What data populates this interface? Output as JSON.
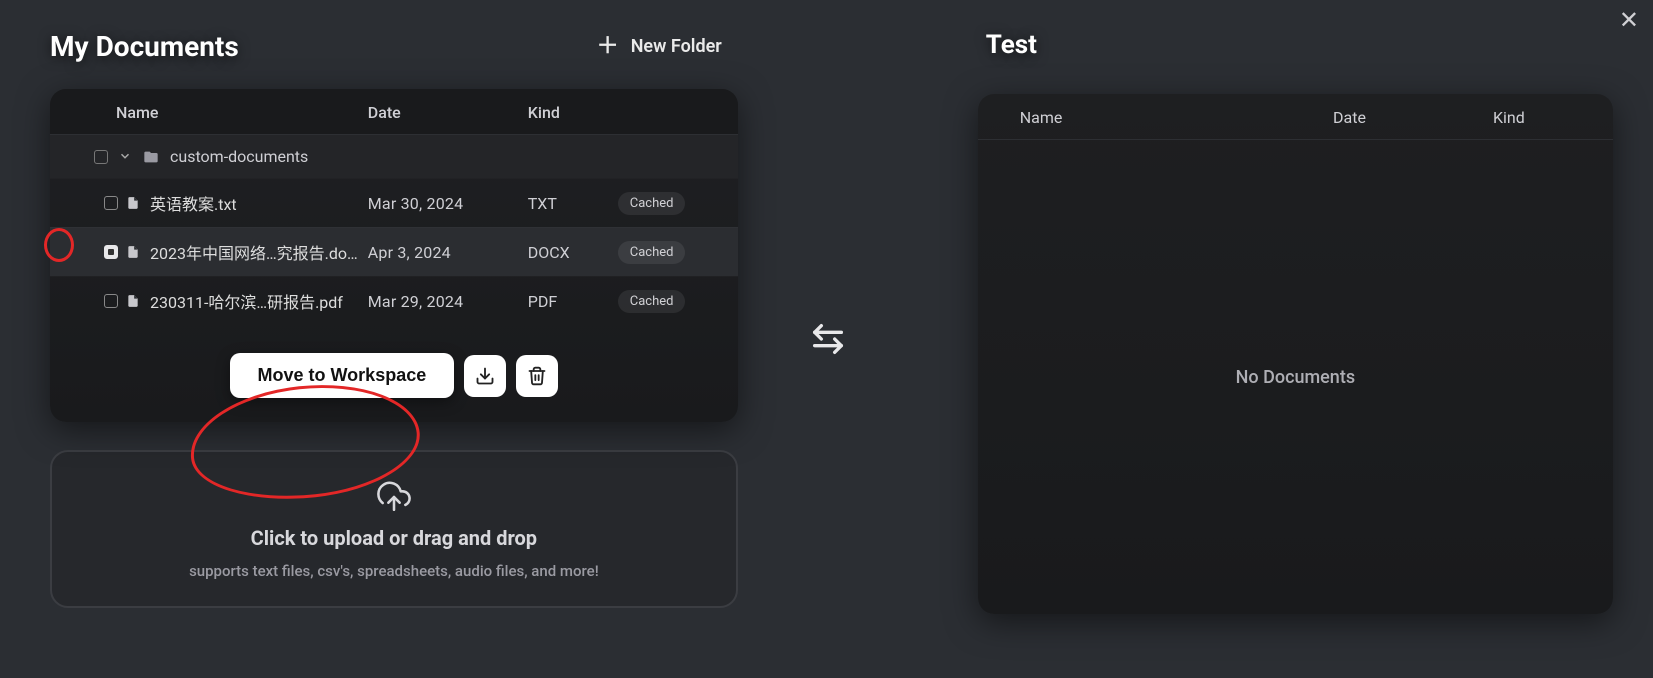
{
  "left": {
    "title": "My Documents",
    "newFolder": "New Folder",
    "columns": {
      "name": "Name",
      "date": "Date",
      "kind": "Kind"
    },
    "folder": "custom-documents",
    "files": [
      {
        "name": "英语教案.txt",
        "date": "Mar 30, 2024",
        "kind": "TXT",
        "status": "Cached",
        "selected": false
      },
      {
        "name": "2023年中国网络…究报告.do…",
        "date": "Apr 3, 2024",
        "kind": "DOCX",
        "status": "Cached",
        "selected": true
      },
      {
        "name": "230311-哈尔滨…研报告.pdf",
        "date": "Mar 29, 2024",
        "kind": "PDF",
        "status": "Cached",
        "selected": false
      }
    ],
    "actions": {
      "move": "Move to Workspace"
    },
    "upload": {
      "title": "Click to upload or drag and drop",
      "sub": "supports text files, csv's, spreadsheets, audio files, and more!"
    }
  },
  "right": {
    "title": "Test",
    "columns": {
      "name": "Name",
      "date": "Date",
      "kind": "Kind"
    },
    "empty": "No Documents"
  }
}
